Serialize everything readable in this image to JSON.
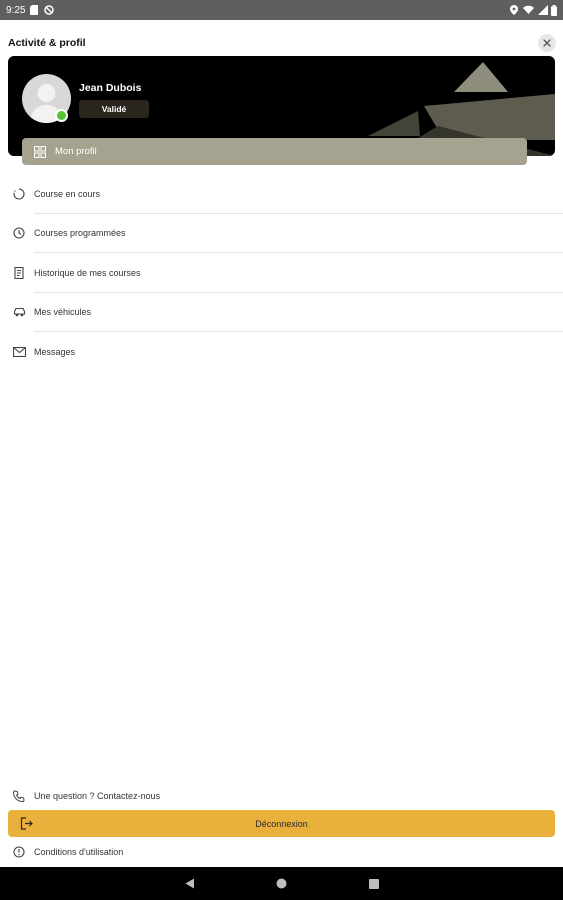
{
  "status_bar": {
    "time": "9:25",
    "icons_left": [
      "sd-card-icon",
      "do-not-disturb-icon"
    ],
    "icons_right": [
      "location-icon",
      "wifi-icon",
      "signal-icon",
      "battery-icon"
    ]
  },
  "header": {
    "title": "Activité & profil",
    "close_icon": "close-icon"
  },
  "profile": {
    "name": "Jean Dubois",
    "status": "Validé",
    "online": true,
    "button_label": "Mon profil",
    "button_icon": "grid-icon"
  },
  "menu": {
    "items": [
      {
        "label": "Course en cours",
        "icon": "progress-circle-icon"
      },
      {
        "label": "Courses programmées",
        "icon": "clock-icon"
      },
      {
        "label": "Historique de mes courses",
        "icon": "receipt-icon"
      },
      {
        "label": "Mes véhicules",
        "icon": "car-icon"
      },
      {
        "label": "Messages",
        "icon": "mail-icon"
      }
    ]
  },
  "footer": {
    "contact_label": "Une question ? Contactez-nous",
    "contact_icon": "phone-icon",
    "logout_label": "Déconnexion",
    "logout_icon": "logout-icon",
    "terms_label": "Conditions d'utilisation",
    "terms_icon": "info-icon"
  },
  "colors": {
    "accent_logout": "#e9b13b",
    "profile_button": "#a5a28f",
    "online_indicator": "#55c234",
    "banner": "#000000"
  },
  "nav_bar": {
    "buttons": [
      "back-icon",
      "home-icon",
      "recents-icon"
    ]
  }
}
